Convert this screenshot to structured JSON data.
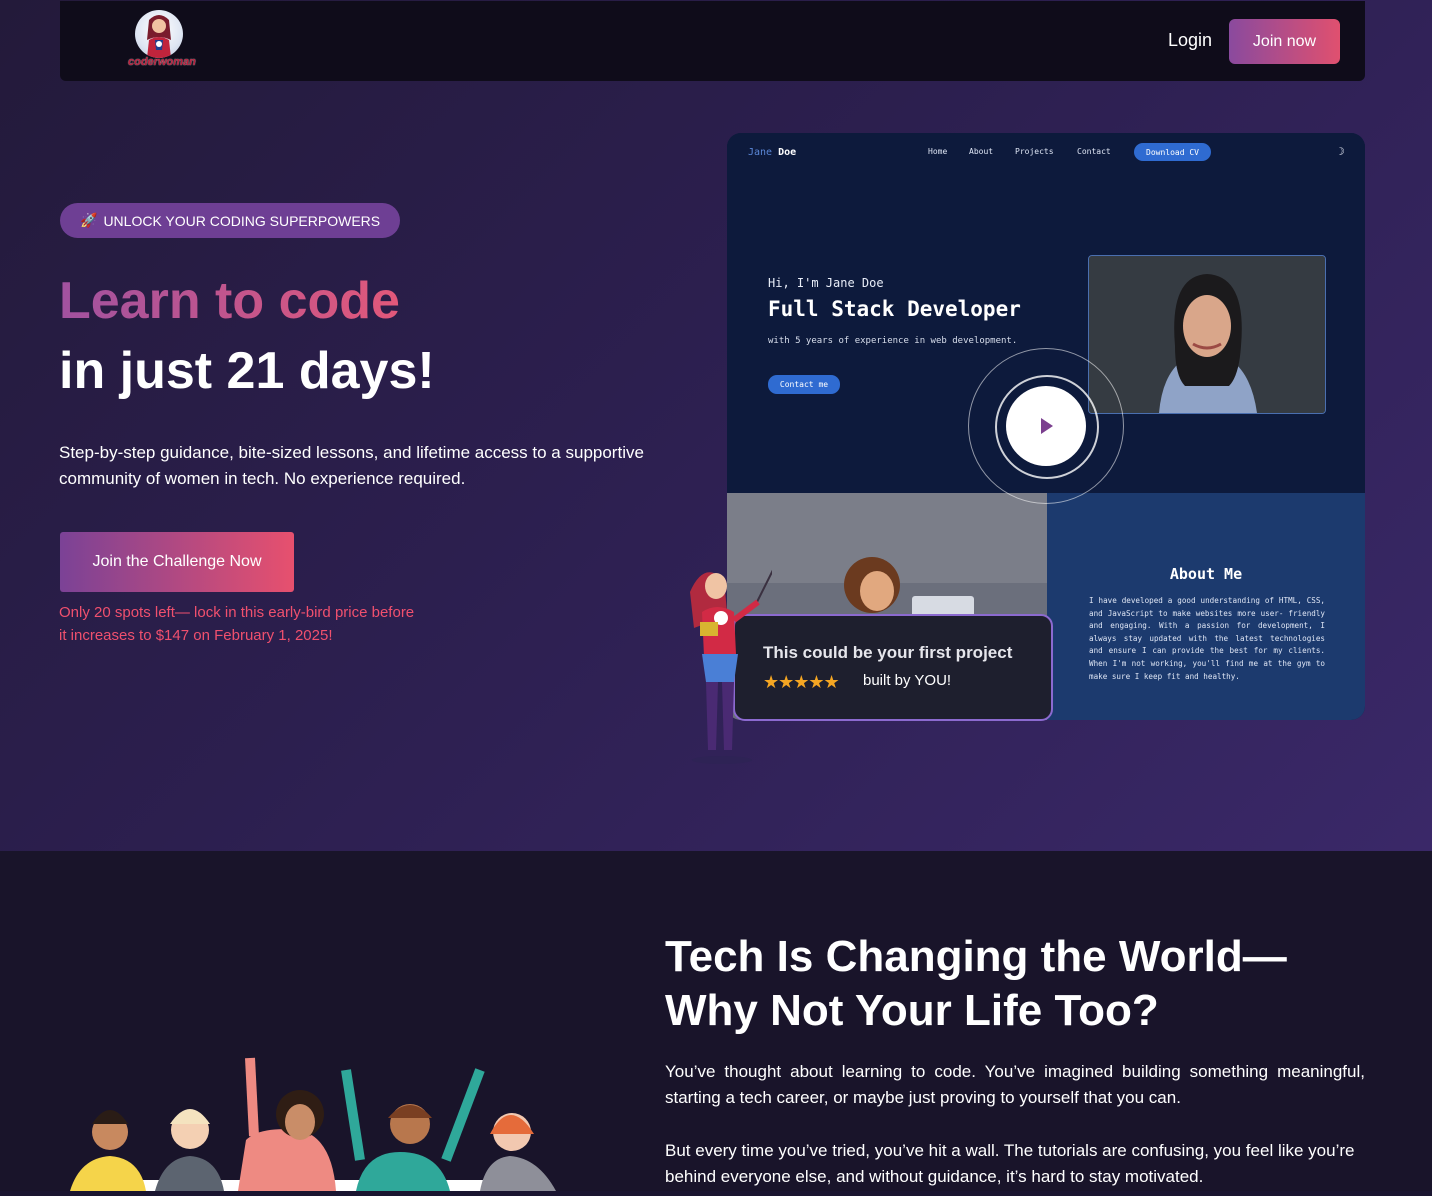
{
  "colors": {
    "accent_gradient_start": "#7b4296",
    "accent_gradient_end": "#e7506e",
    "urgency_text": "#f0506e",
    "hero_bg": "#2c1f4f",
    "section_bg": "#19142a"
  },
  "header": {
    "logo_text": "coderwoman",
    "login_label": "Login",
    "join_label": "Join now"
  },
  "hero": {
    "eyebrow_icon": "rocket-icon",
    "eyebrow_emoji": "🚀",
    "eyebrow_label": "UNLOCK YOUR CODING SUPERPOWERS",
    "headline_1": "Learn to code",
    "headline_2": "in just 21 days!",
    "description": "Step-by-step guidance, bite-sized lessons, and lifetime access to a supportive community of women in tech. No experience required.",
    "cta_label": "Join the Challenge Now",
    "urgency_text": "Only 20 spots left— lock in this early-bird price before it increases to $147 on February 1, 2025!"
  },
  "mockup": {
    "brand_first": "Jane",
    "brand_last": "Doe",
    "nav": [
      "Home",
      "About",
      "Projects",
      "Contact"
    ],
    "cv_button": "Download CV",
    "moon_icon": "☽",
    "greeting": "Hi, I'm Jane Doe",
    "role": "Full Stack Developer",
    "experience": "with 5 years of experience in web development.",
    "contact_button": "Contact me",
    "about_title": "About Me",
    "about_text": "I have developed a good understanding of HTML, CSS, and JavaScript to make websites more user- friendly and engaging. With a passion for development, I always stay updated with the latest technologies and ensure I can provide the best for my clients. When I'm not working, you'll find me at the gym to make sure I keep fit and healthy."
  },
  "project_card": {
    "title": "This could be your first project",
    "stars": "★★★★★",
    "rating": 5,
    "built_by": "built by YOU!"
  },
  "section2": {
    "title_line_1": "Tech Is Changing the World—",
    "title_line_2": "Why Not Your Life Too?",
    "paragraph_1": "You’ve thought about learning to code. You’ve imagined building something meaningful, starting a tech career, or maybe just proving to yourself that you can.",
    "paragraph_2": "But every time you’ve tried, you’ve hit a wall. The tutorials are confusing, you feel like you’re behind everyone else, and without guidance, it’s hard to stay motivated."
  }
}
